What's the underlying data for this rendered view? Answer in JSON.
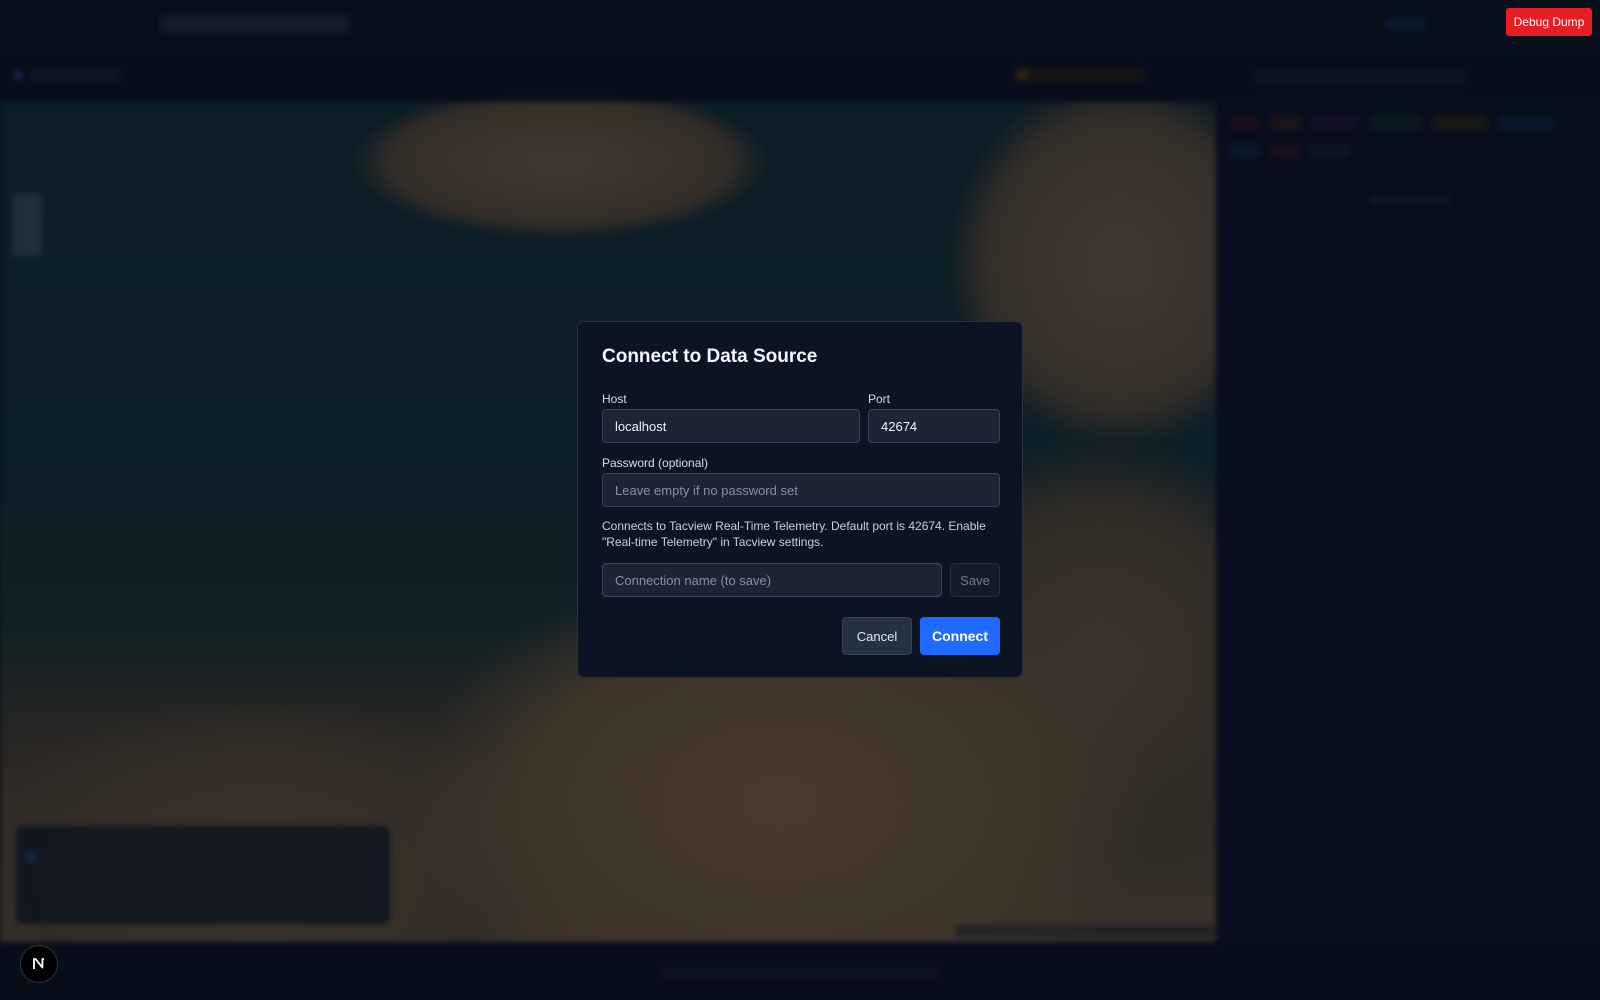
{
  "debug": {
    "label": "Debug Dump"
  },
  "modal": {
    "title": "Connect to Data Source",
    "host": {
      "label": "Host",
      "value": "localhost"
    },
    "port": {
      "label": "Port",
      "value": "42674"
    },
    "password": {
      "label": "Password (optional)",
      "placeholder": "Leave empty if no password set"
    },
    "hint": "Connects to Tacview Real-Time Telemetry. Default port is 42674. Enable \"Real-time Telemetry\" in Tacview settings.",
    "connection_name": {
      "placeholder": "Connection name (to save)"
    },
    "save_label": "Save",
    "cancel_label": "Cancel",
    "connect_label": "Connect"
  },
  "badge": {
    "letter": "N"
  },
  "colors": {
    "accent": "#1f6bff",
    "debug": "#e81c23",
    "modal_bg": "#0c1322",
    "field_bg": "#1c2534"
  },
  "icons": [
    "nextjs-n-icon"
  ]
}
